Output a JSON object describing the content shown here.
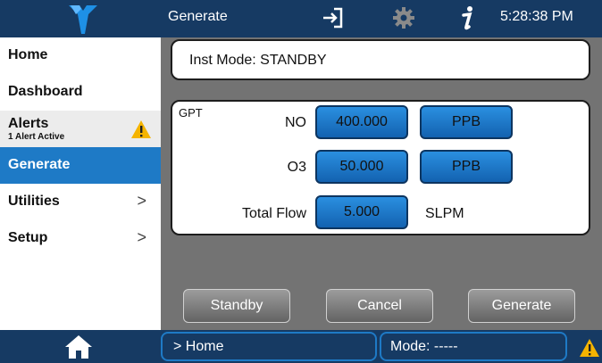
{
  "header": {
    "title": "Generate",
    "time": "5:28:38 PM",
    "icons": [
      "teledyne-logo",
      "login-icon",
      "gear-icon",
      "info-icon"
    ]
  },
  "sidebar": {
    "items": [
      {
        "label": "Home"
      },
      {
        "label": "Dashboard"
      },
      {
        "label": "Alerts",
        "sublabel": "1 Alert Active"
      },
      {
        "label": "Generate",
        "selected": true
      },
      {
        "label": "Utilities",
        "chevron": ">"
      },
      {
        "label": "Setup",
        "chevron": ">"
      }
    ]
  },
  "main": {
    "inst_mode": "Inst Mode:  STANDBY",
    "gpt": {
      "title": "GPT",
      "rows": [
        {
          "label": "NO",
          "value": "400.000",
          "unit": "PPB"
        },
        {
          "label": "O3",
          "value": "50.000",
          "unit": "PPB"
        },
        {
          "label": "Total Flow",
          "value": "5.000",
          "unit": "SLPM"
        }
      ]
    },
    "buttons": {
      "standby": "Standby",
      "cancel": "Cancel",
      "generate": "Generate"
    }
  },
  "footer": {
    "breadcrumb": "> Home",
    "mode": "Mode: -----"
  },
  "colors": {
    "bar": "#163a63",
    "accent": "#1e7ac6",
    "warning": "#f5b400",
    "panel": "#737373"
  }
}
